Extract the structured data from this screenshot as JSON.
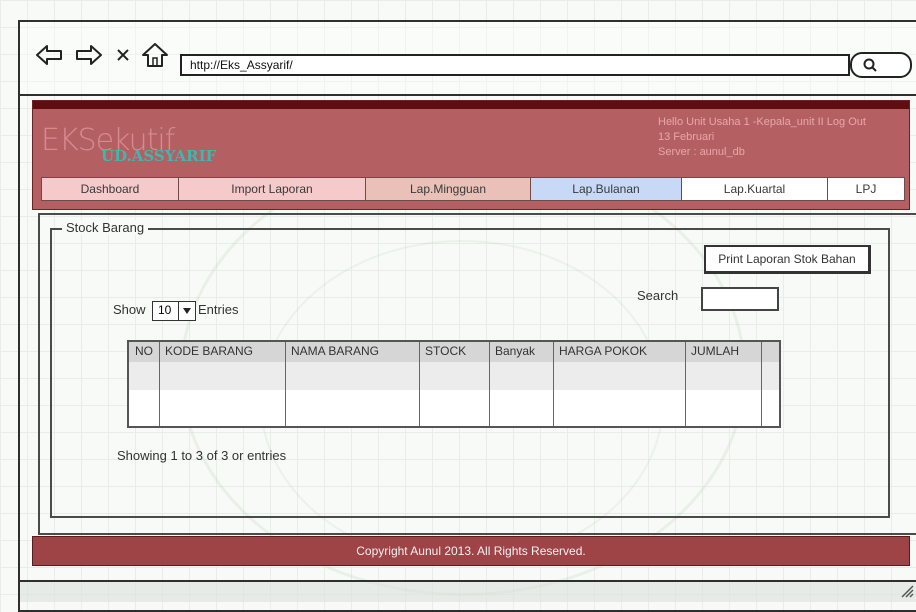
{
  "browser": {
    "url": "http://Eks_Assyarif/"
  },
  "header": {
    "logo_main": "EKSekutif",
    "logo_sub": "UD.ASSYARIF",
    "greeting": "Hello Unit Usaha 1 -Kepala_unit II",
    "logout_label": "Log Out",
    "date": "13 Februari",
    "server": "Server : aunul_db"
  },
  "nav": {
    "tabs": [
      {
        "label": "Dashboard",
        "color": "#f6c9cb"
      },
      {
        "label": "Import Laporan",
        "color": "#f6c9cb"
      },
      {
        "label": "Lap.Mingguan",
        "color": "#e9c1b8"
      },
      {
        "label": "Lap.Bulanan",
        "color": "#c7d9f7"
      },
      {
        "label": "Lap.Kuartal",
        "color": "#ffffff"
      },
      {
        "label": "LPJ",
        "color": "#ffffff"
      }
    ]
  },
  "main": {
    "legend": "Stock Barang",
    "print_button": "Print Laporan Stok Bahan",
    "show_label": "Show",
    "entries_value": "10",
    "entries_label": "Entries",
    "search_label": "Search",
    "search_value": "",
    "table": {
      "columns": [
        "NO",
        "KODE BARANG",
        "NAMA BARANG",
        "STOCK",
        "Banyak",
        "HARGA POKOK",
        "JUMLAH"
      ]
    },
    "showing_text": "Showing 1 to 3 of 3 or entries"
  },
  "footer": {
    "copyright": "Copyright Aunul 2013. All Rights Reserved."
  }
}
